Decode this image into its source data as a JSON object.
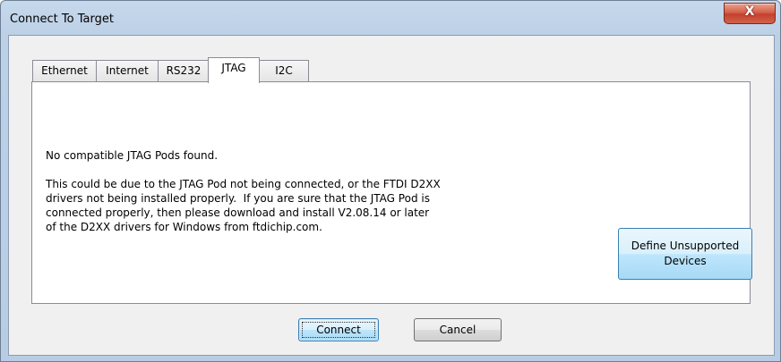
{
  "window": {
    "title": "Connect To Target",
    "close_glyph": "X"
  },
  "tabs": [
    {
      "label": "Ethernet",
      "active": false
    },
    {
      "label": "Internet",
      "active": false
    },
    {
      "label": "RS232",
      "active": false
    },
    {
      "label": "JTAG",
      "active": true
    },
    {
      "label": "I2C",
      "active": false
    }
  ],
  "panel": {
    "heading": "No compatible JTAG Pods found.",
    "body_lines": [
      "This could be due to the JTAG Pod not being connected, or the FTDI D2XX",
      "drivers not being installed properly.  If you are sure that the JTAG Pod is",
      "connected properly, then please download and install V2.08.14 or later",
      "of the D2XX drivers for Windows from ftdichip.com."
    ],
    "define_button": {
      "line1": "Define Unsupported",
      "line2": "Devices"
    }
  },
  "buttons": {
    "connect": "Connect",
    "cancel": "Cancel"
  },
  "colors": {
    "frame": "#bcd0e6",
    "client": "#f0f0f0",
    "close_red": "#c4412c",
    "default_button_border": "#3c7fb1"
  }
}
